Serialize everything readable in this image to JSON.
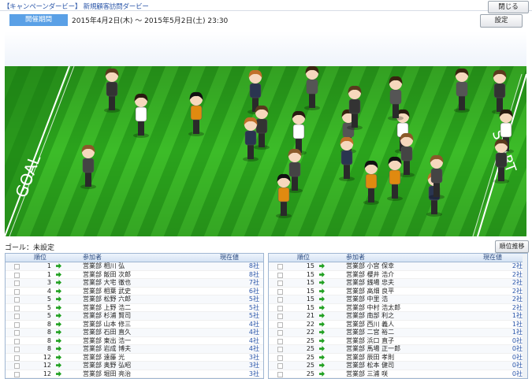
{
  "header": {
    "title": "【キャンペーンダービー】 新規顧客訪問ダービー",
    "close_label": "閉じる"
  },
  "period": {
    "label": "開催期間",
    "value": "2015年4月2日(木) ～ 2015年5月2日(土) 23:30",
    "settings_label": "設定"
  },
  "race": {
    "goal_text": "GOAL",
    "start_text": "START",
    "colors": {
      "grass_dark": "#1e8a16",
      "grass_light": "#3cbc28"
    }
  },
  "goal_status": "ゴール：未設定",
  "ranking_button": "順位推移",
  "table": {
    "columns": {
      "rank": "順位",
      "participant": "参加者",
      "value": "現在値"
    },
    "left_rows": [
      {
        "rank": "1",
        "name": "営業部 相川 弘",
        "value": "8社"
      },
      {
        "rank": "1",
        "name": "営業部 飯田 次郎",
        "value": "8社"
      },
      {
        "rank": "3",
        "name": "営業部 大宅 徹也",
        "value": "7社"
      },
      {
        "rank": "4",
        "name": "営業部 相葉 武史",
        "value": "6社"
      },
      {
        "rank": "5",
        "name": "営業部 松野 六郎",
        "value": "5社"
      },
      {
        "rank": "5",
        "name": "営業部 上野 浩二",
        "value": "5社"
      },
      {
        "rank": "5",
        "name": "営業部 杉浦 賢司",
        "value": "5社"
      },
      {
        "rank": "8",
        "name": "営業部 山本 修三",
        "value": "4社"
      },
      {
        "rank": "8",
        "name": "営業部 石田 直久",
        "value": "4社"
      },
      {
        "rank": "8",
        "name": "営業部 東出 浩一",
        "value": "4社"
      },
      {
        "rank": "8",
        "name": "営業部 岩成 博夫",
        "value": "4社"
      },
      {
        "rank": "12",
        "name": "営業部 遠藤 光",
        "value": "3社"
      },
      {
        "rank": "12",
        "name": "営業部 奥野 弘昭",
        "value": "3社"
      },
      {
        "rank": "12",
        "name": "営業部 堀田 亮治",
        "value": "3社"
      }
    ],
    "right_rows": [
      {
        "rank": "15",
        "name": "営業部 小宮 保幸",
        "value": "2社"
      },
      {
        "rank": "15",
        "name": "営業部 櫻井 浩介",
        "value": "2社"
      },
      {
        "rank": "15",
        "name": "営業部 銭場 忠夫",
        "value": "2社"
      },
      {
        "rank": "15",
        "name": "営業部 高畑 良平",
        "value": "2社"
      },
      {
        "rank": "15",
        "name": "営業部 中里 浩",
        "value": "2社"
      },
      {
        "rank": "15",
        "name": "営業部 中村 浩太郎",
        "value": "2社"
      },
      {
        "rank": "21",
        "name": "営業部 南部 利之",
        "value": "1社"
      },
      {
        "rank": "22",
        "name": "営業部 西川 義人",
        "value": "1社"
      },
      {
        "rank": "22",
        "name": "営業部 二宮 裕二",
        "value": "1社"
      },
      {
        "rank": "25",
        "name": "営業部 浜口 直子",
        "value": "0社"
      },
      {
        "rank": "25",
        "name": "営業部 馬場 正一郎",
        "value": "0社"
      },
      {
        "rank": "25",
        "name": "営業部 辰田 孝則",
        "value": "0社"
      },
      {
        "rank": "25",
        "name": "営業部 松本 健司",
        "value": "0社"
      },
      {
        "rank": "25",
        "name": "営業部 三浦 咲",
        "value": "0社"
      }
    ]
  }
}
